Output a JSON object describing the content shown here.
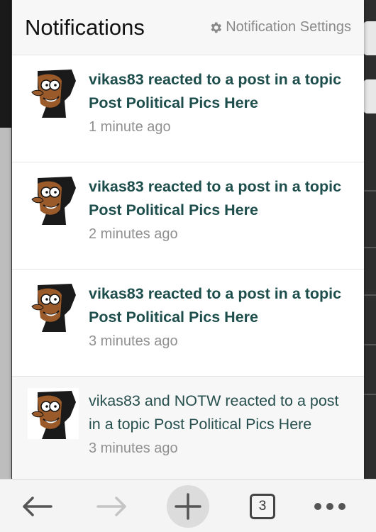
{
  "header": {
    "title": "Notifications",
    "settings_label": "Notification Settings"
  },
  "notifications": [
    {
      "text": "vikas83 reacted to a post in a topic Post Political Pics Here",
      "time": "1 minute ago"
    },
    {
      "text": "vikas83 reacted to a post in a topic Post Political Pics Here",
      "time": "2 minutes ago"
    },
    {
      "text": "vikas83 reacted to a post in a topic Post Political Pics Here",
      "time": "3 minutes ago"
    },
    {
      "text": "vikas83 and NOTW reacted to a post in a topic Post Political Pics Here",
      "time": "3 minutes ago"
    }
  ],
  "toolbar": {
    "back_icon": "arrow-left-icon",
    "forward_icon": "arrow-right-icon",
    "new_tab_icon": "plus-icon",
    "tab_count": "3",
    "more_icon": "more-dots-icon"
  },
  "colors": {
    "link_text": "#1d4e4c",
    "muted_text": "#909090",
    "header_bg": "#f7f7f7"
  }
}
